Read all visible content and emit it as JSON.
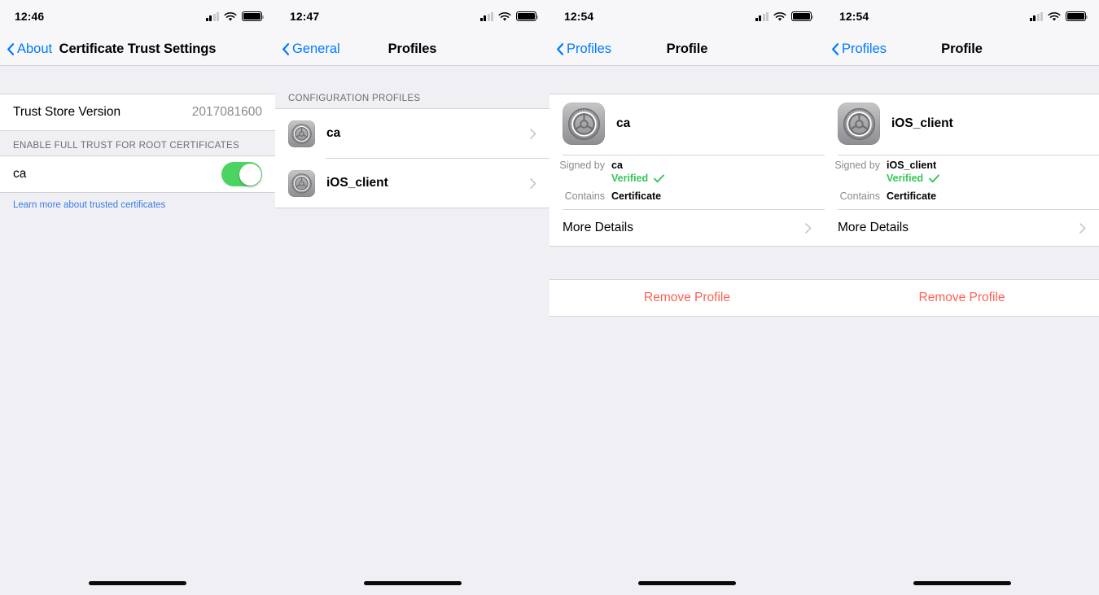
{
  "panels": [
    {
      "id": "certificate-trust-settings",
      "status": {
        "time": "12:46",
        "cellular": "signal-bars-icon",
        "wifi": "wifi-icon",
        "battery": "battery-full-icon"
      },
      "nav": {
        "back_label": "About",
        "title": "Certificate Trust Settings"
      },
      "trust_store": {
        "label": "Trust Store Version",
        "value": "2017081600"
      },
      "section_header": "ENABLE FULL TRUST FOR ROOT CERTIFICATES",
      "cert_row": {
        "label": "ca",
        "toggle_state": "on",
        "toggle_color": "#4CD462"
      },
      "footer_link": "Learn more about trusted certificates"
    },
    {
      "id": "profiles-list",
      "status": {
        "time": "12:47",
        "cellular": "signal-bars-icon",
        "wifi": "wifi-icon",
        "battery": "battery-full-icon"
      },
      "nav": {
        "back_label": "General",
        "title": "Profiles"
      },
      "section_header": "CONFIGURATION PROFILES",
      "items": [
        {
          "name": "ca",
          "icon": "settings-app-icon",
          "accessory": "chevron-right-icon"
        },
        {
          "name": "iOS_client",
          "icon": "settings-app-icon",
          "accessory": "chevron-right-icon"
        }
      ]
    },
    {
      "id": "profile-detail-ca",
      "status": {
        "time": "12:54",
        "cellular": "signal-bars-icon",
        "wifi": "wifi-icon",
        "battery": "battery-full-icon"
      },
      "nav": {
        "back_label": "Profiles",
        "title": "Profile"
      },
      "profile": {
        "name": "ca",
        "icon": "settings-app-icon",
        "signed_by_key": "Signed by",
        "signed_by_value": "ca",
        "verified_text": "Verified",
        "verified_color": "#35C759",
        "contains_key": "Contains",
        "contains_value": "Certificate"
      },
      "more_details": "More Details",
      "remove_label": "Remove Profile",
      "remove_color": "#FB6055"
    },
    {
      "id": "profile-detail-ios-client",
      "status": {
        "time": "12:54",
        "cellular": "signal-bars-icon",
        "wifi": "wifi-icon",
        "battery": "battery-full-icon"
      },
      "nav": {
        "back_label": "Profiles",
        "title": "Profile"
      },
      "profile": {
        "name": "iOS_client",
        "icon": "settings-app-icon",
        "signed_by_key": "Signed by",
        "signed_by_value": "iOS_client",
        "verified_text": "Verified",
        "verified_color": "#35C759",
        "contains_key": "Contains",
        "contains_value": "Certificate"
      },
      "more_details": "More Details",
      "remove_label": "Remove Profile",
      "remove_color": "#FB6055"
    }
  ]
}
